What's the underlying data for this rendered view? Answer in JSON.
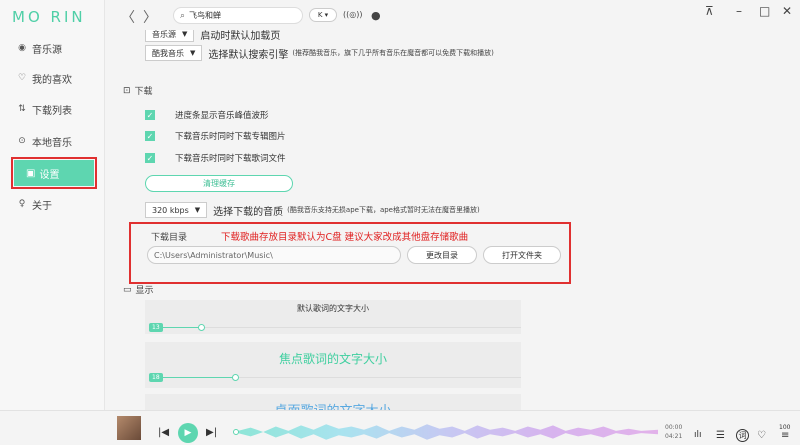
{
  "app": {
    "logo": "MO RIN"
  },
  "sidebar": {
    "items": [
      {
        "label": "音乐源",
        "icon": "record-icon",
        "glyph": "◉"
      },
      {
        "label": "我的喜欢",
        "icon": "heart-icon",
        "glyph": "♡"
      },
      {
        "label": "下载列表",
        "icon": "download-sort-icon",
        "glyph": "⇅"
      },
      {
        "label": "本地音乐",
        "icon": "disc-icon",
        "glyph": "⊙"
      },
      {
        "label": "设置",
        "icon": "settings-icon",
        "glyph": "▣"
      },
      {
        "label": "关于",
        "icon": "bulb-icon",
        "glyph": "♀"
      }
    ]
  },
  "topbar": {
    "back_glyph": "〈",
    "forward_glyph": "〉",
    "search_value": "飞鸟和蝉",
    "search_glyph": "⌕",
    "source_label": "K ▾",
    "listen_glyph": "((◎))",
    "record_glyph": "●",
    "pin_glyph": "⊼",
    "min_glyph": "–",
    "max_glyph": "□",
    "close_glyph": "✕"
  },
  "settings": {
    "top_partial": {
      "select": "音乐源",
      "text": "启动时默认加载页"
    },
    "search_engine": {
      "select": "酷我音乐",
      "label": "选择默认搜索引擎",
      "hint": "(推荐酷我音乐，旗下几乎所有音乐在魔音都可以免费下载和播放)"
    },
    "download_section": {
      "title": "下载",
      "options": [
        "进度条显示音乐峰值波形",
        "下载音乐时同时下载专辑图片",
        "下载音乐时同时下载歌词文件"
      ],
      "clear_cache": "清理缓存",
      "quality": {
        "select": "320 kbps",
        "label": "选择下载的音质",
        "hint": "(酷我音乐支持无损ape下载，ape格式暂时无法在魔音里播放)"
      },
      "dir": {
        "label": "下载目录",
        "note": "下载歌曲存放目录默认为C盘 建议大家改成其他盘存储歌曲",
        "path": "C:\\Users\\Administrator\\Music\\",
        "change": "更改目录",
        "open": "打开文件夹"
      }
    },
    "display_section": {
      "title": "显示",
      "default_lyric": {
        "title": "默认歌词的文字大小",
        "value": "13",
        "fraction": 0.15
      },
      "focus_lyric": {
        "title": "焦点歌词的文字大小",
        "value": "18",
        "fraction": 0.24
      },
      "desktop_lyric": {
        "title": "桌面歌词的文字大小"
      }
    }
  },
  "player": {
    "prev_glyph": "|◀",
    "play_glyph": "▶",
    "next_glyph": "▶|",
    "time_elapsed": "00:00",
    "time_total": "04:21",
    "volume": "100",
    "eq_glyph": "ılı",
    "list_glyph": "☰",
    "lyric_glyph": "词",
    "like_glyph": "♡",
    "menu_glyph": "≡"
  },
  "colors": {
    "accent": "#5ed6b0",
    "highlight": "#e03030"
  }
}
